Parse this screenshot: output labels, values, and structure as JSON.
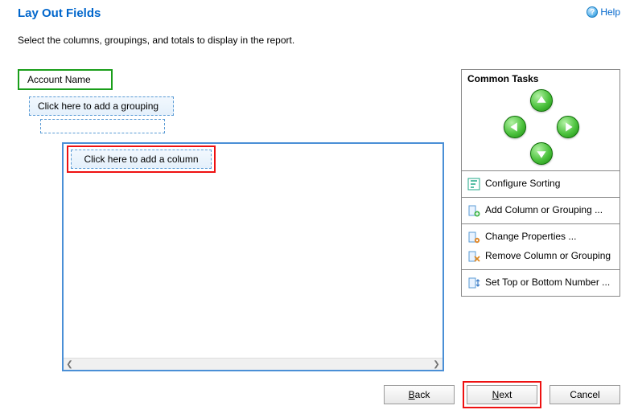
{
  "header": {
    "title": "Lay Out Fields",
    "help_label": "Help"
  },
  "instruction": "Select the columns, groupings, and totals to display in the report.",
  "layout": {
    "account_label": "Account Name",
    "add_grouping_label": "Click here to add a grouping",
    "add_column_label": "Click here to add a column"
  },
  "tasks": {
    "title": "Common Tasks",
    "configure_sorting": "Configure Sorting",
    "add_column_grouping": "Add Column or Grouping ...",
    "change_properties": "Change Properties ...",
    "remove_column_grouping": "Remove Column or Grouping",
    "set_top_bottom": "Set Top or Bottom Number ..."
  },
  "buttons": {
    "back": "Back",
    "next": "Next",
    "cancel": "Cancel"
  }
}
